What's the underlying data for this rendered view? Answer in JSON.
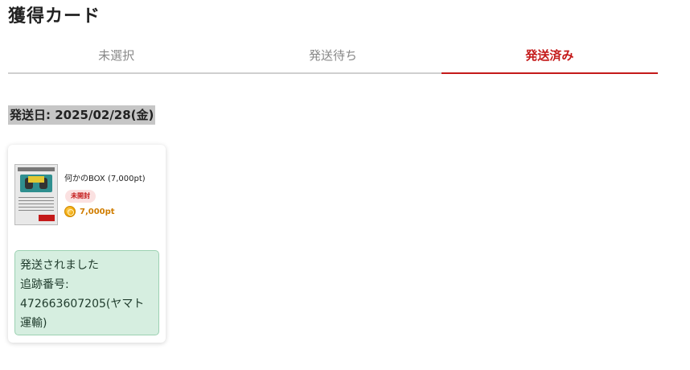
{
  "page": {
    "title": "獲得カード"
  },
  "tabs": [
    {
      "label": "未選択",
      "active": false
    },
    {
      "label": "発送待ち",
      "active": false
    },
    {
      "label": "発送済み",
      "active": true
    }
  ],
  "shipment": {
    "date_label": "発送日: 2025/02/28(金)"
  },
  "card": {
    "name": "何かのBOX (7,000pt)",
    "status": "未開封",
    "points": "7,000pt",
    "icons": {
      "points": "coin-icon"
    },
    "notice": {
      "line1": "発送されました",
      "line2": "追跡番号:",
      "line3": "472663607205(ヤマト運輸)"
    }
  },
  "colors": {
    "accent": "#c41a1a",
    "badge_bg": "#fbe1e1",
    "notice_bg": "#d6eee0",
    "points": "#d07d00"
  }
}
